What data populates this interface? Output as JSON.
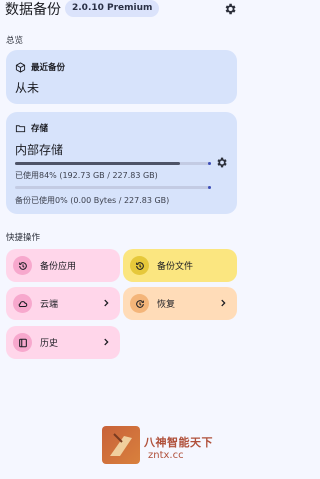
{
  "app": {
    "title": "数据备份",
    "version": "2.0.10 Premium"
  },
  "overview": {
    "section_label": "总览",
    "last_backup": {
      "label": "最近备份",
      "value": "从未"
    },
    "storage": {
      "label": "存储",
      "location": "内部存储",
      "used_text": "已使用84% (192.73 GB / 227.83 GB)",
      "used_fraction": 0.84,
      "backup_text": "备份已使用0% (0.00 Bytes / 227.83 GB)",
      "backup_fraction": 0.0
    }
  },
  "quick_actions": {
    "section_label": "快捷操作",
    "tiles": [
      {
        "label": "备份应用",
        "icon": "restore-clock-icon",
        "color": "#ffd6ea",
        "icon_bg": "#f7a8cd"
      },
      {
        "label": "备份文件",
        "icon": "restore-clock-icon",
        "color": "#fbe680",
        "icon_bg": "#e6c83a"
      },
      {
        "label": "云端",
        "icon": "cloud-icon",
        "color": "#ffd6ea",
        "icon_bg": "#f7a8cd"
      },
      {
        "label": "恢复",
        "icon": "restore-icon",
        "color": "#ffdcb8",
        "icon_bg": "#f4b579"
      },
      {
        "label": "历史",
        "icon": "history-icon",
        "color": "#ffd6ea",
        "icon_bg": "#f7a8cd"
      }
    ]
  },
  "watermark": {
    "line1": "八神智能天下",
    "line2": "zntx.cc"
  }
}
